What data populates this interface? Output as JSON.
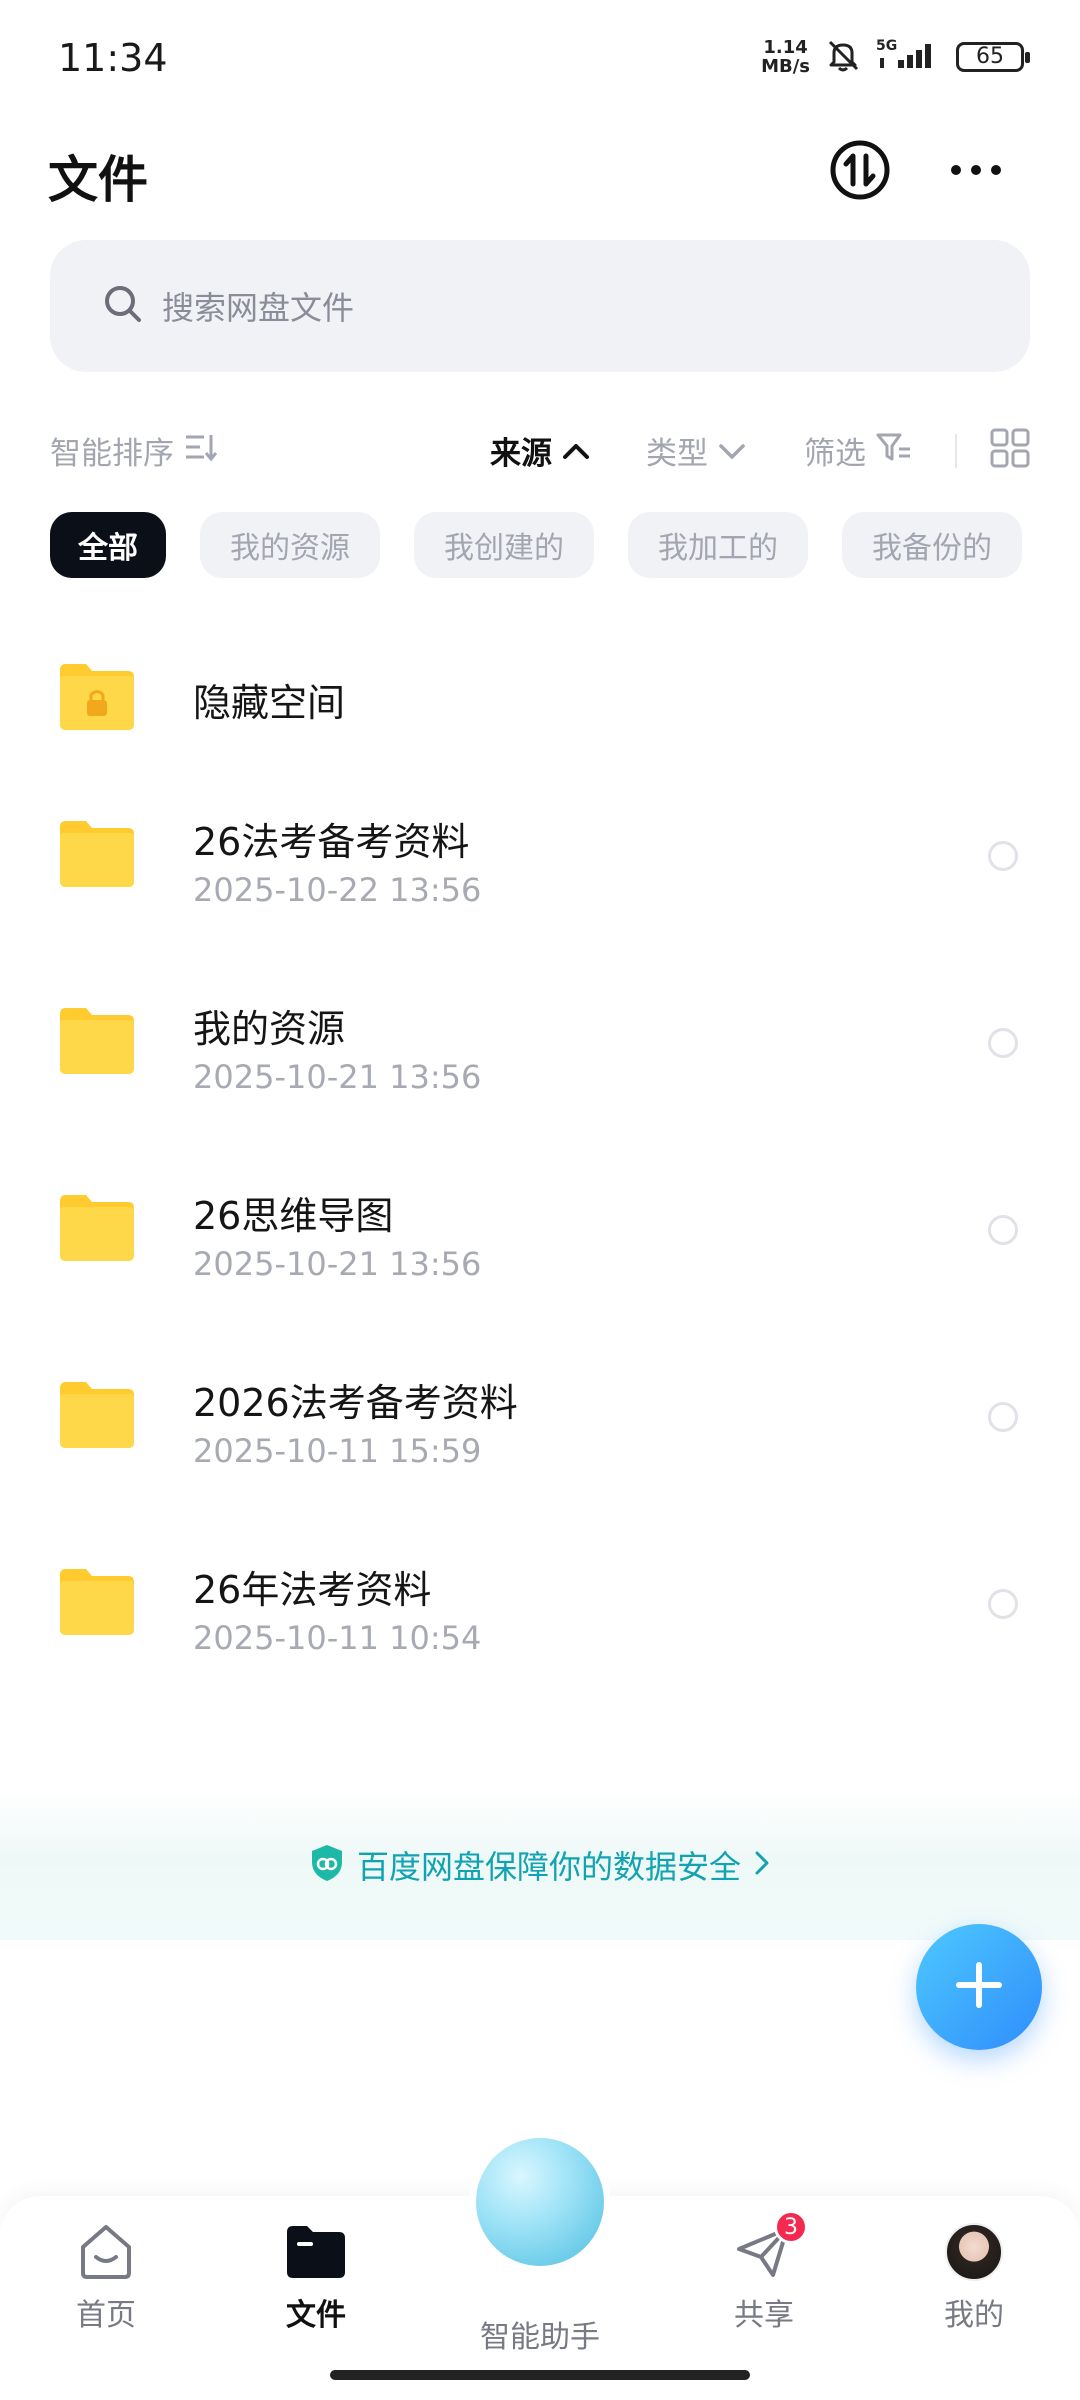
{
  "status_bar": {
    "time": "11:34",
    "net_speed_value": "1.14",
    "net_speed_unit": "MB/s",
    "network": "5G",
    "battery": "65"
  },
  "header": {
    "title": "文件"
  },
  "search": {
    "placeholder": "搜索网盘文件"
  },
  "sortbar": {
    "sort_label": "智能排序",
    "source_label": "来源",
    "type_label": "类型",
    "filter_label": "筛选"
  },
  "chips": [
    {
      "label": "全部",
      "active": true
    },
    {
      "label": "我的资源",
      "active": false
    },
    {
      "label": "我创建的",
      "active": false
    },
    {
      "label": "我加工的",
      "active": false
    },
    {
      "label": "我备份的",
      "active": false
    }
  ],
  "files": [
    {
      "name": "隐藏空间",
      "date": "",
      "locked": true
    },
    {
      "name": "26法考备考资料",
      "date": "2025-10-22  13:56"
    },
    {
      "name": "我的资源",
      "date": "2025-10-21  13:56"
    },
    {
      "name": "26思维导图",
      "date": "2025-10-21  13:56"
    },
    {
      "name": "2026法考备考资料",
      "date": "2025-10-11  15:59"
    },
    {
      "name": "26年法考资料",
      "date": "2025-10-11  10:54"
    }
  ],
  "security_banner": {
    "text": "百度网盘保障你的数据安全"
  },
  "bottom_nav": {
    "items": [
      {
        "label": "首页",
        "icon": "home-icon"
      },
      {
        "label": "文件",
        "icon": "folder-icon",
        "active": true
      },
      {
        "label": "智能助手",
        "icon": "assistant-orb-icon"
      },
      {
        "label": "共享",
        "icon": "share-icon",
        "badge": "3"
      },
      {
        "label": "我的",
        "icon": "avatar"
      }
    ]
  },
  "colors": {
    "accent": "#2f8dfb",
    "folder": "#ffd84a",
    "badge": "#f5294f",
    "security_text": "#12a3b3"
  }
}
